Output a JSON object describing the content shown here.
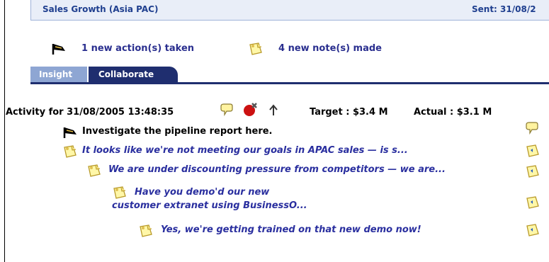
{
  "header": {
    "title": "Sales Growth (Asia PAC)",
    "sent_label": "Sent: 31/08/2"
  },
  "summary": {
    "actions_text": "1 new action(s) taken",
    "notes_text": "4 new note(s) made"
  },
  "tabs": [
    {
      "label": "Insight",
      "active": false
    },
    {
      "label": "Collaborate",
      "active": true
    }
  ],
  "activity": {
    "label": "Activity for 31/08/2005 13:48:35",
    "target": "Target : $3.4 M",
    "actual": "Actual : $3.1 M"
  },
  "thread": [
    {
      "type": "action",
      "text": "Investigate the pipeline report here."
    },
    {
      "type": "note",
      "text": "It looks like we're not meeting our goals in APAC sales — is s..."
    },
    {
      "type": "note",
      "text": "We are under discounting pressure from competitors — we are..."
    },
    {
      "type": "note",
      "text": "Have you demo'd our new customer extranet using BusinessO..."
    },
    {
      "type": "note",
      "text": "Yes, we're getting trained on that new demo now!"
    }
  ],
  "colors": {
    "header_text": "#1f3f8f",
    "tab_active": "#1f2e6f",
    "tab_inactive": "#8ea6d3",
    "note_text": "#2a2f9f"
  },
  "icons": {
    "action": "flag-icon",
    "note": "note-icon",
    "comment": "comment-icon",
    "delete": "delete-icon",
    "up": "arrow-up-icon",
    "reply": "reply-icon"
  }
}
